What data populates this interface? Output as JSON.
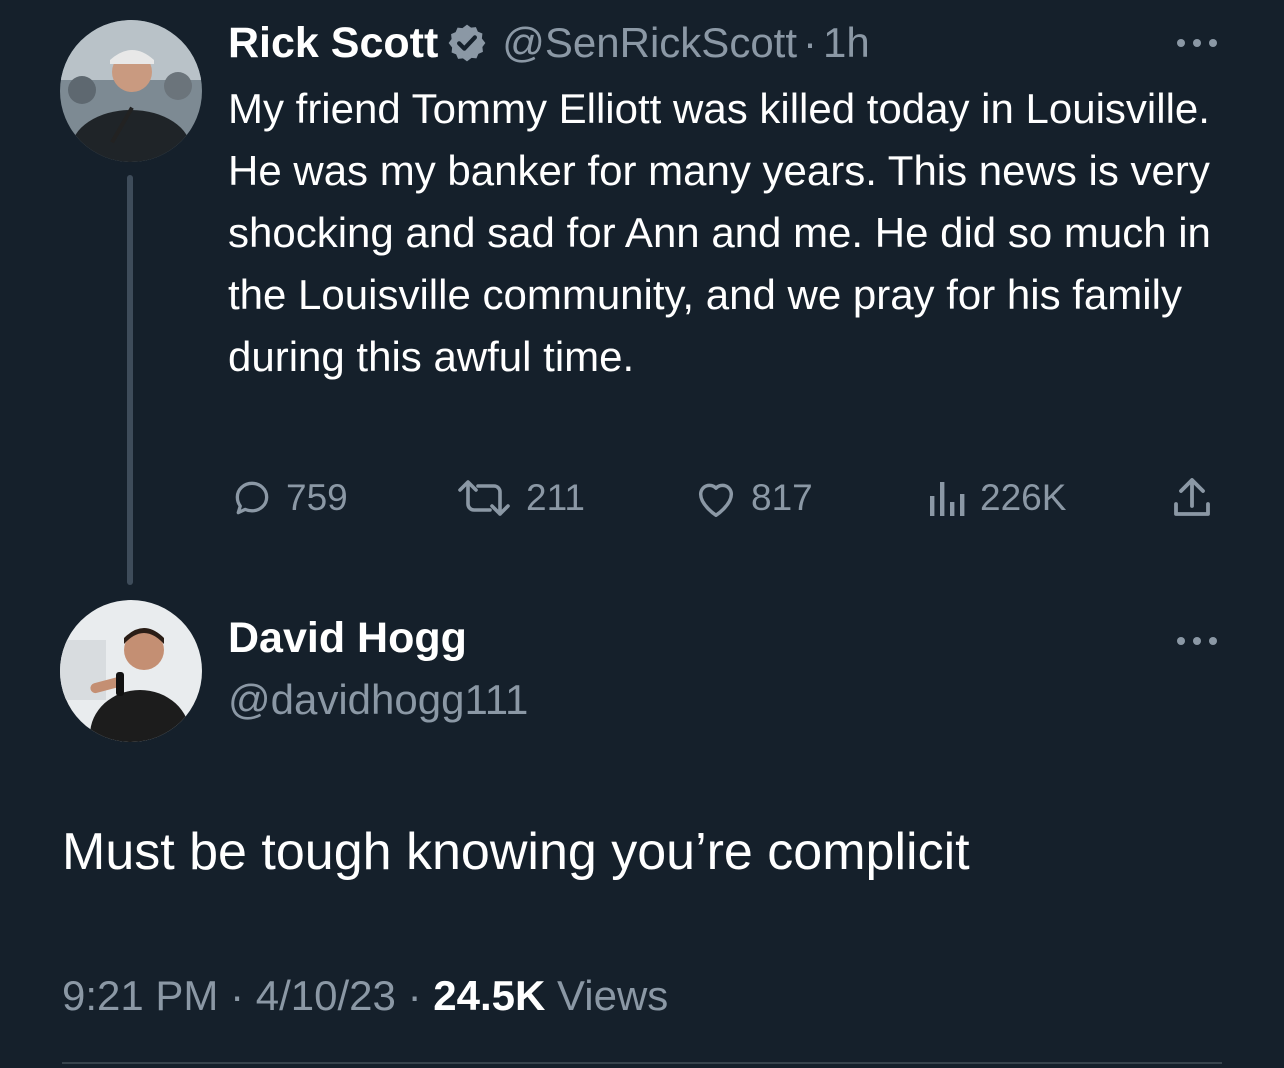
{
  "parent_tweet": {
    "author_name": "Rick Scott",
    "handle": "@SenRickScott",
    "separator": "·",
    "time_ago": "1h",
    "verified": true,
    "text": "My friend Tommy Elliott was killed today in Louisville. He was my banker for many years. This news is very shocking and sad for Ann and me. He did so much in the Louisville community, and we pray for his family during this awful time.",
    "actions": {
      "replies": "759",
      "retweets": "211",
      "likes": "817",
      "views": "226K"
    },
    "icons": {
      "reply": "speech-bubble-icon",
      "retweet": "retweet-arrows-icon",
      "like": "heart-icon",
      "views": "bar-chart-icon",
      "share": "share-upload-icon",
      "more": "more-dots-icon",
      "verified": "verified-badge-icon"
    }
  },
  "reply_tweet": {
    "author_name": "David Hogg",
    "handle": "@davidhogg111",
    "text": "Must be tough knowing you’re complicit",
    "time": "9:21 PM",
    "separator": "·",
    "date": "4/10/23",
    "views_count": "24.5K",
    "views_label": "Views"
  },
  "colors": {
    "background": "#15202b",
    "primary_text": "#ffffff",
    "secondary_text": "#8b98a5",
    "thread_line": "#3e4c5a",
    "divider": "#38444d",
    "verified_badge": "#8b98a5"
  }
}
